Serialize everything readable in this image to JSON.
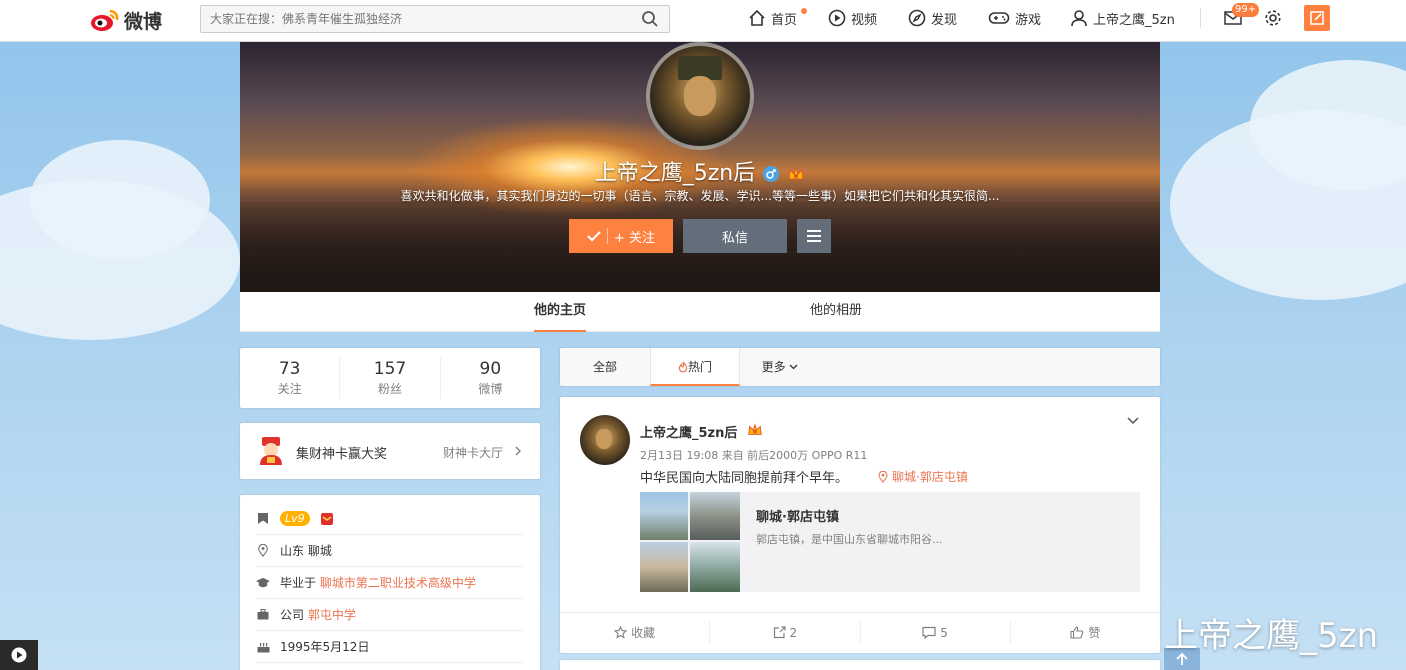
{
  "topbar": {
    "logo_text": "微博",
    "search_placeholder": "大家正在搜：佛系青年催生孤独经济",
    "nav": [
      {
        "label": "首页",
        "icon": "home-icon"
      },
      {
        "label": "视频",
        "icon": "video-icon"
      },
      {
        "label": "发现",
        "icon": "discover-icon"
      },
      {
        "label": "游戏",
        "icon": "game-icon"
      },
      {
        "label": "上帝之鹰_5zn",
        "icon": "user-icon"
      }
    ],
    "message_badge": "99+"
  },
  "profile": {
    "name": "上帝之鹰_5zn后",
    "bio": "喜欢共和化做事，其实我们身边的一切事（语言、宗教、发展、学识...等等一些事）如果把它们共和化其实很简...",
    "follow_label": "+ 关注",
    "message_label": "私信",
    "tabs": [
      "他的主页",
      "他的相册"
    ]
  },
  "stats": [
    {
      "value": "73",
      "label": "关注"
    },
    {
      "value": "157",
      "label": "粉丝"
    },
    {
      "value": "90",
      "label": "微博"
    }
  ],
  "promo": {
    "title": "集财神卡赢大奖",
    "link": "财神卡大厅"
  },
  "info": {
    "level": "Lv9",
    "location": "山东 聊城",
    "school_prefix": "毕业于",
    "school": "聊城市第二职业技术高级中学",
    "company_prefix": "公司",
    "company": "郭屯中学",
    "birthday": "1995年5月12日"
  },
  "feed_tabs": [
    "全部",
    "热门",
    "更多"
  ],
  "post": {
    "author": "上帝之鹰_5zn后",
    "meta": "2月13日 19:08 来自 前后2000万 OPPO R11",
    "text": "中华民国向大陆同胞提前拜个早年。",
    "location_tag": "聊城·郭店屯镇",
    "card_title": "聊城·郭店屯镇",
    "card_desc": "郭店屯镇，是中国山东省聊城市阳谷...",
    "actions": [
      {
        "icon": "star-icon",
        "label": "收藏"
      },
      {
        "icon": "share-icon",
        "label": "2"
      },
      {
        "icon": "comment-icon",
        "label": "5"
      },
      {
        "icon": "like-icon",
        "label": "赞"
      }
    ]
  },
  "watermark": "上帝之鹰_5zn",
  "colors": {
    "accent": "#ff8140",
    "link": "#eb7350",
    "dark_button": "#636e7a"
  }
}
